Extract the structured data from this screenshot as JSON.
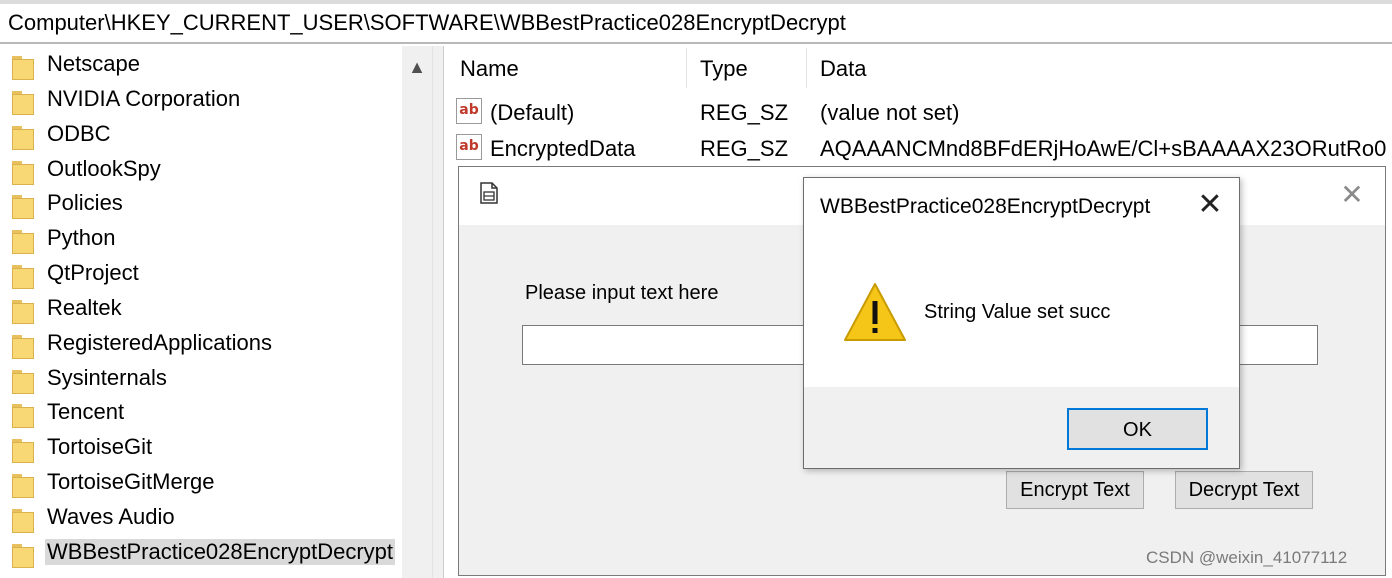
{
  "address_bar": {
    "path": "Computer\\HKEY_CURRENT_USER\\SOFTWARE\\WBBestPractice028EncryptDecrypt"
  },
  "tree": {
    "items": [
      {
        "label": "Netscape"
      },
      {
        "label": "NVIDIA Corporation"
      },
      {
        "label": "ODBC"
      },
      {
        "label": "OutlookSpy"
      },
      {
        "label": "Policies"
      },
      {
        "label": "Python"
      },
      {
        "label": "QtProject"
      },
      {
        "label": "Realtek"
      },
      {
        "label": "RegisteredApplications"
      },
      {
        "label": "Sysinternals"
      },
      {
        "label": "Tencent"
      },
      {
        "label": "TortoiseGit"
      },
      {
        "label": "TortoiseGitMerge"
      },
      {
        "label": "Waves Audio"
      },
      {
        "label": "WBBestPractice028EncryptDecrypt",
        "selected": true
      }
    ]
  },
  "values_list": {
    "columns": {
      "name": "Name",
      "type": "Type",
      "data": "Data"
    },
    "rows": [
      {
        "icon": "string-value-icon",
        "name": "(Default)",
        "type": "REG_SZ",
        "data": "(value not set)"
      },
      {
        "icon": "string-value-icon",
        "name": "EncryptedData",
        "type": "REG_SZ",
        "data": "AQAAANCMnd8BFdERjHoAwE/Cl+sBAAAAX23ORutRo0"
      }
    ]
  },
  "app_window": {
    "input_label": "Please input text here",
    "input_value": "",
    "encrypt_button": "Encrypt Text",
    "decrypt_button": "Decrypt Text"
  },
  "message_box": {
    "title": "WBBestPractice028EncryptDecrypt",
    "message": "String Value set succ",
    "icon": "warning-icon",
    "ok_button": "OK"
  },
  "watermark": "CSDN @weixin_41077112",
  "colors": {
    "folder": "#f8d775",
    "selection": "#d9d9d9",
    "ok_border": "#0078d7",
    "warning": "#f5c518"
  }
}
